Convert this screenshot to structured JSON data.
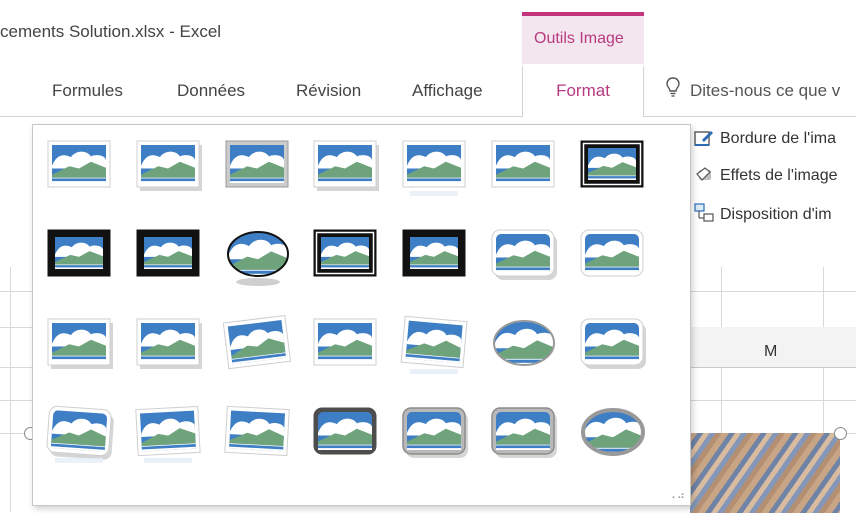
{
  "window": {
    "title": "cements Solution.xlsx - Excel"
  },
  "context_tab_group": {
    "label": "Outils Image",
    "accent": "#c2357c"
  },
  "ribbon_tabs": [
    {
      "label": "Formules",
      "active": false
    },
    {
      "label": "Données",
      "active": false
    },
    {
      "label": "Révision",
      "active": false
    },
    {
      "label": "Affichage",
      "active": false
    },
    {
      "label": "Format",
      "active": true
    }
  ],
  "tell_me": {
    "text": "Dites-nous ce que v",
    "icon": "lightbulb-icon"
  },
  "ribbon_commands": [
    {
      "label": "Bordure de l'ima",
      "icon": "picture-border-icon"
    },
    {
      "label": "Effets de l'image",
      "icon": "picture-effects-icon"
    },
    {
      "label": "Disposition d'im",
      "icon": "picture-layout-icon"
    }
  ],
  "sheet": {
    "column_header": "M"
  },
  "picture_styles": {
    "count": 28,
    "columns": 7,
    "items": [
      "Cadre simple, blanc",
      "Cadre, ombré",
      "Cadre simple, noir",
      "Rectangle à ombre portée",
      "Rectangle à réflexion",
      "Rectangle à bords adoucis",
      "Cadre double, noir",
      "Cadre épais, noir",
      "Cadre simple, noir 2",
      "Ellipse à ombre",
      "Cadre métallique noir",
      "Cadre épais noir 2",
      "Rectangle arrondi ombré",
      "Rectangle arrondi blanc",
      "Cadre blanc, coin plié",
      "Cadre blanc, ombré",
      "Perspective inclinée",
      "Perspective ombrée",
      "Perspective relief",
      "Ovale à bords adoucis",
      "Rectangle arrondi",
      "Biseau perspective",
      "Reflet perspective",
      "Rotation blanc",
      "Cadre métallique",
      "Ovale, cadre métallique",
      "Rectangle arrondi métallique",
      "Ovale métallique"
    ]
  }
}
